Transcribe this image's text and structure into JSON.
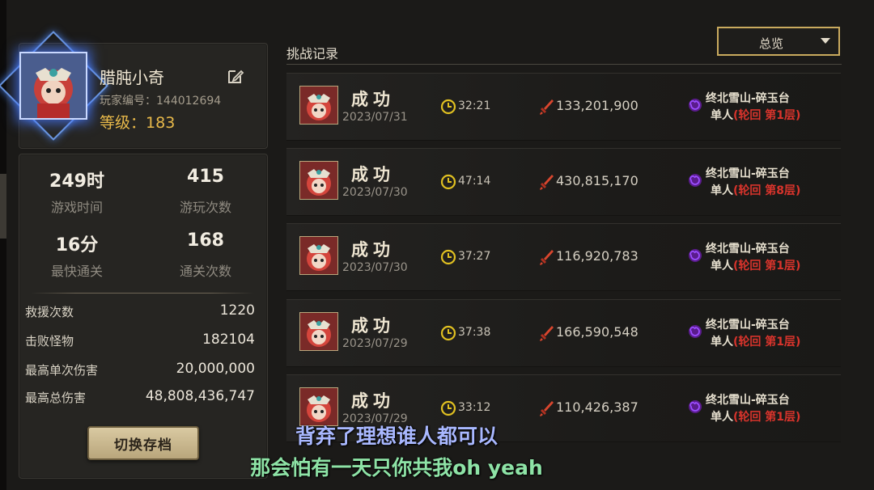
{
  "profile": {
    "name": "腊肫小奇",
    "player_id_label": "玩家编号：",
    "player_id": "144012694",
    "level_label": "等级：",
    "level": "183"
  },
  "stats": [
    {
      "value": "249时",
      "label": "游戏时间"
    },
    {
      "value": "415",
      "label": "游玩次数"
    },
    {
      "value": "16分",
      "label": "最快通关"
    },
    {
      "value": "168",
      "label": "通关次数"
    }
  ],
  "details": [
    {
      "label": "救援次数",
      "value": "1220"
    },
    {
      "label": "击败怪物",
      "value": "182104"
    },
    {
      "label": "最高单次伤害",
      "value": "20,000,000"
    },
    {
      "label": "最高总伤害",
      "value": "48,808,436,747"
    }
  ],
  "switch_button": "切换存档",
  "section_title": "挑战记录",
  "filter": {
    "selected": "总览"
  },
  "records": [
    {
      "result": "成功",
      "date": "2023/07/31",
      "time": "32:21",
      "damage": "133,201,900",
      "location": "终北雪山-碎玉台",
      "mode_prefix": "单人",
      "mode_detail": "(轮回  第1层)"
    },
    {
      "result": "成功",
      "date": "2023/07/30",
      "time": "47:14",
      "damage": "430,815,170",
      "location": "终北雪山-碎玉台",
      "mode_prefix": "单人",
      "mode_detail": "(轮回  第8层)"
    },
    {
      "result": "成功",
      "date": "2023/07/30",
      "time": "37:27",
      "damage": "116,920,783",
      "location": "终北雪山-碎玉台",
      "mode_prefix": "单人",
      "mode_detail": "(轮回  第1层)"
    },
    {
      "result": "成功",
      "date": "2023/07/29",
      "time": "37:38",
      "damage": "166,590,548",
      "location": "终北雪山-碎玉台",
      "mode_prefix": "单人",
      "mode_detail": "(轮回  第1层)"
    },
    {
      "result": "成功",
      "date": "2023/07/29",
      "time": "33:12",
      "damage": "110,426,387",
      "location": "终北雪山-碎玉台",
      "mode_prefix": "单人",
      "mode_detail": "(轮回  第1层)"
    }
  ],
  "subtitles": [
    "背弃了理想谁人都可以",
    "那会怕有一天只你共我oh yeah"
  ],
  "colors": {
    "gold": "#c9aa5e",
    "level": "#e8b94a",
    "red": "#d8342c",
    "purple": "#9b4dff",
    "clock": "#e0c021"
  },
  "icons": {
    "edit": "edit-icon",
    "clock": "clock-icon",
    "damage": "sword-icon",
    "location": "swirl-icon",
    "dropdown": "chevron-down-icon"
  }
}
